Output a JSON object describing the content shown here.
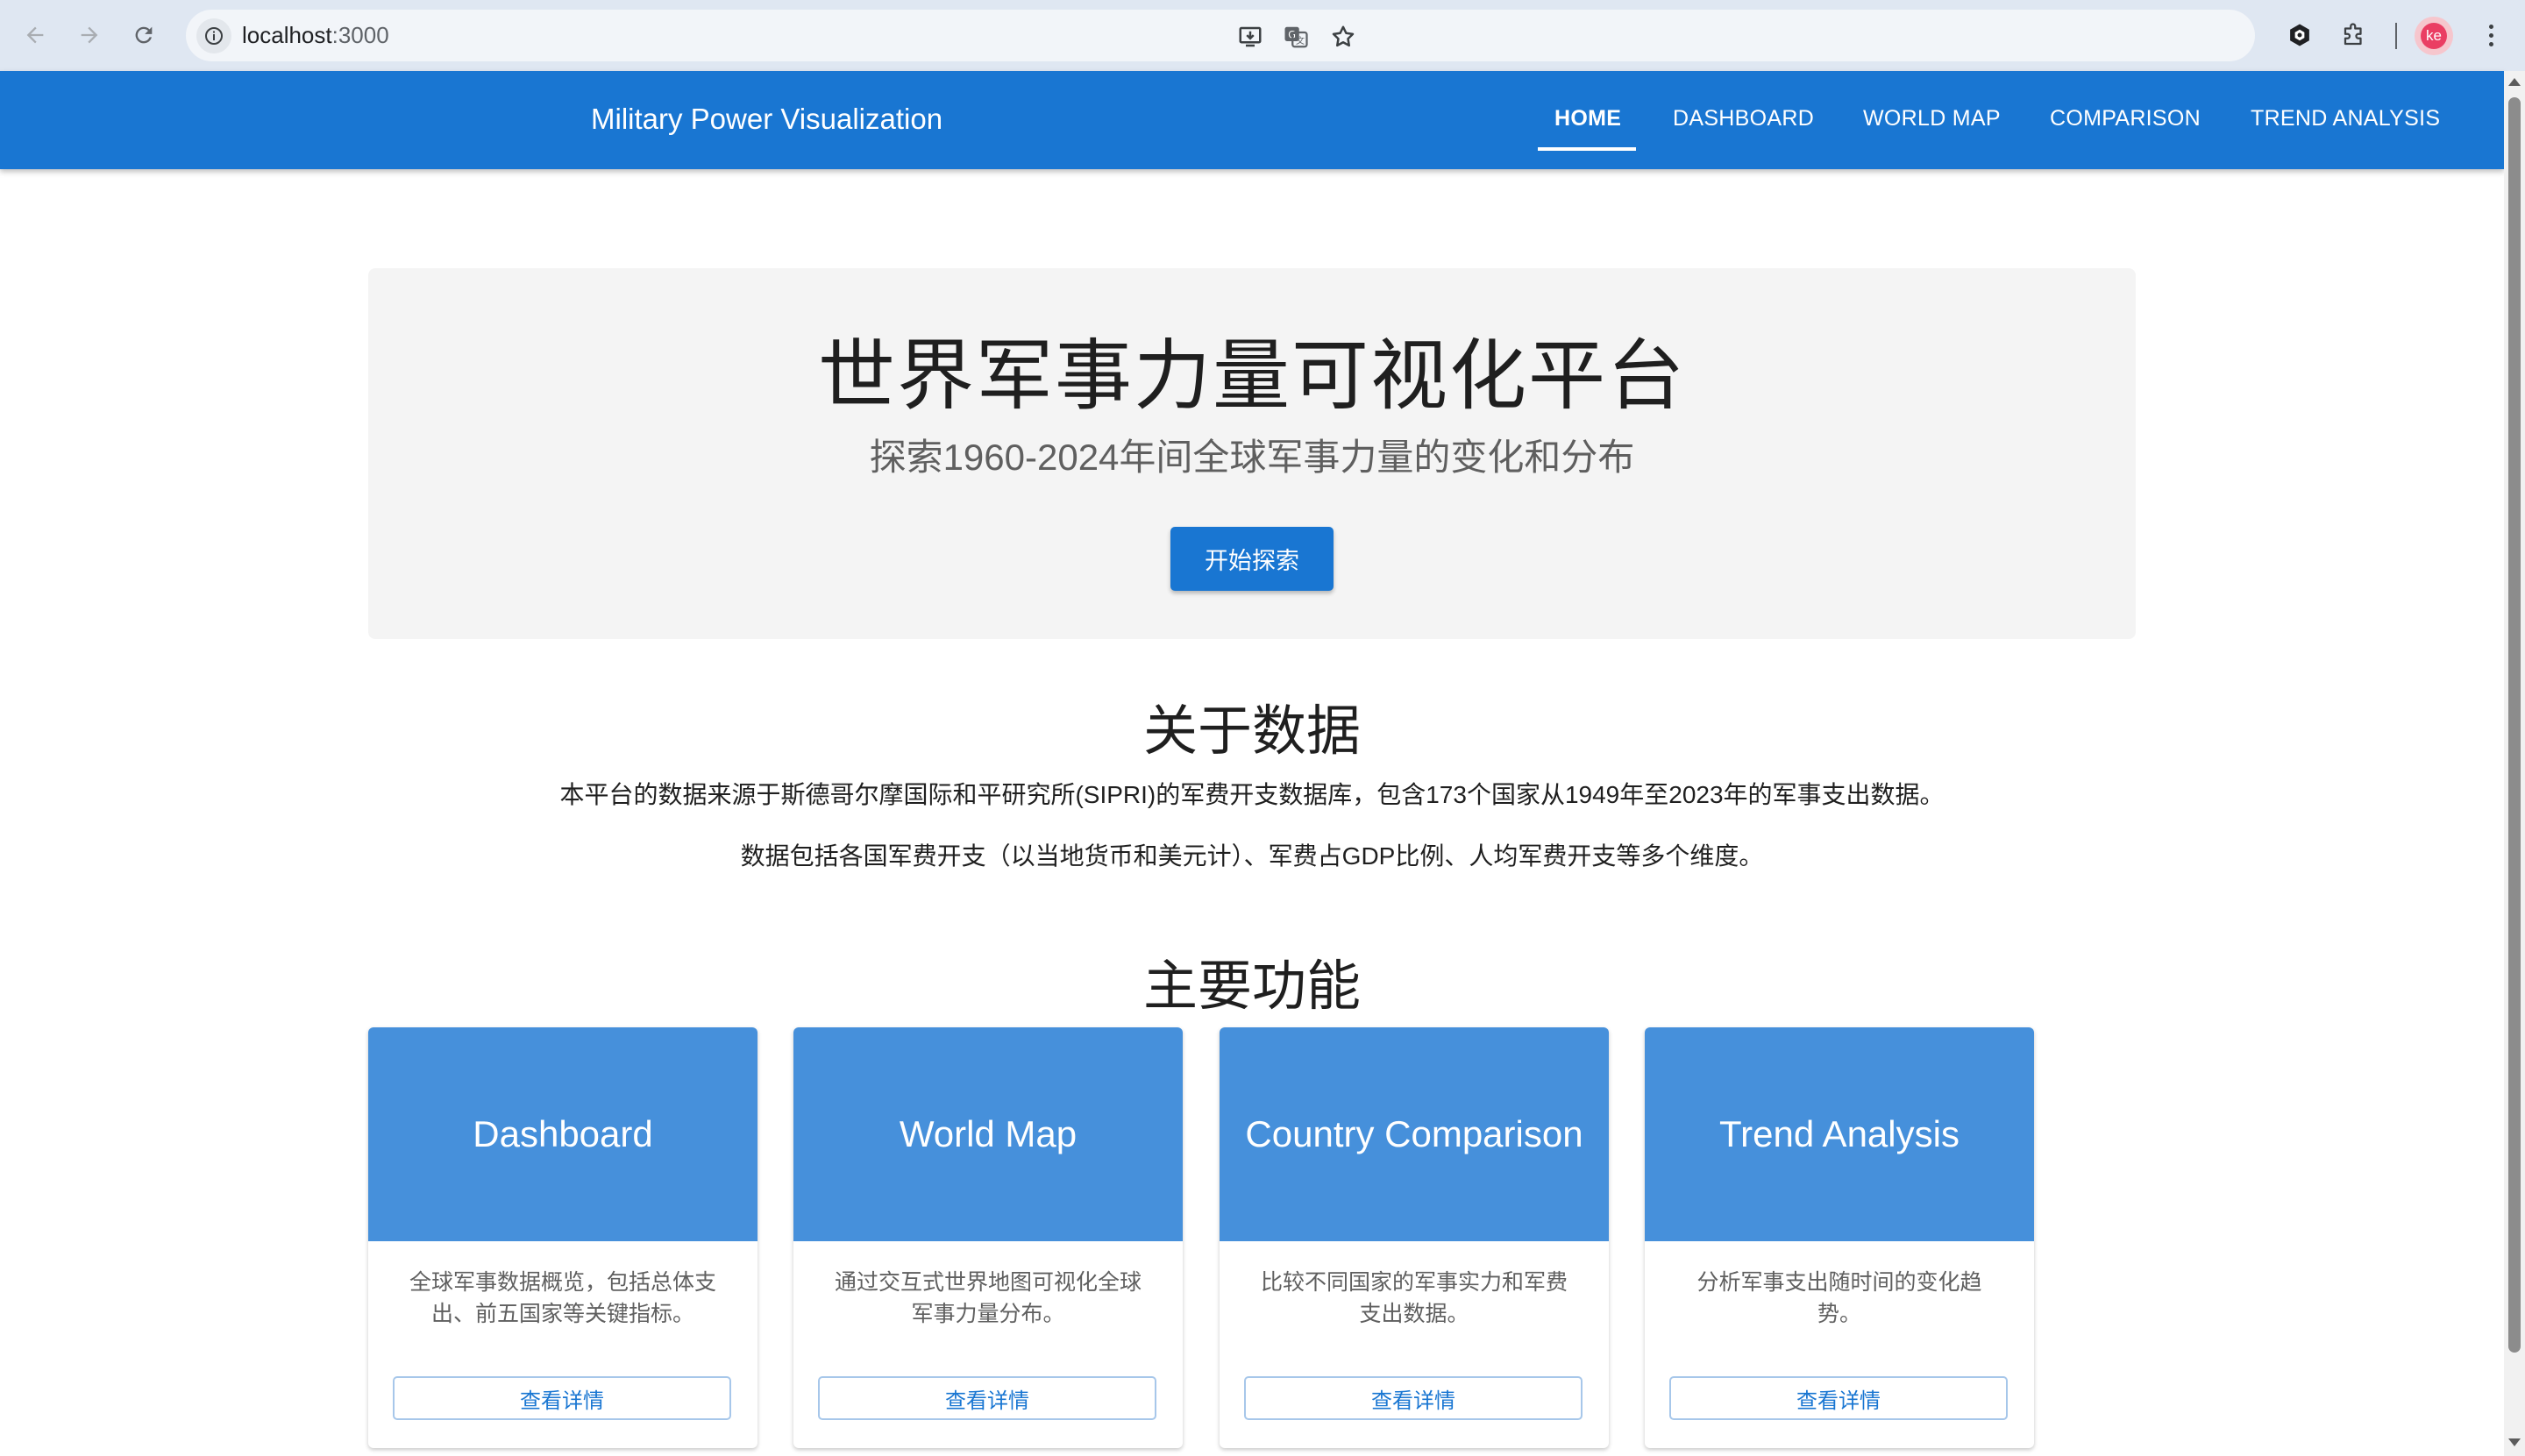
{
  "browser": {
    "url_host": "localhost",
    "url_port": ":3000",
    "avatar_initials": "ke",
    "icons": [
      "back-icon",
      "forward-icon",
      "reload-icon",
      "site-info-icon",
      "install-app-icon",
      "translate-icon",
      "bookmark-star-icon",
      "extension-icon",
      "puzzle-icon",
      "menu-icon"
    ]
  },
  "appbar": {
    "brand": "Military Power Visualization",
    "nav": [
      {
        "label": "HOME",
        "active": true
      },
      {
        "label": "DASHBOARD"
      },
      {
        "label": "WORLD MAP"
      },
      {
        "label": "COMPARISON"
      },
      {
        "label": "TREND ANALYSIS"
      }
    ],
    "color": "#1976d2"
  },
  "hero": {
    "title": "世界军事力量可视化平台",
    "subtitle": "探索1960-2024年间全球军事力量的变化和分布",
    "button": "开始探索"
  },
  "about": {
    "title": "关于数据",
    "line1": "本平台的数据来源于斯德哥尔摩国际和平研究所(SIPRI)的军费开支数据库，包含173个国家从1949年至2023年的军事支出数据。",
    "line2": "数据包括各国军费开支（以当地货币和美元计）、军费占GDP比例、人均军费开支等多个维度。"
  },
  "features": {
    "title": "主要功能",
    "cards": [
      {
        "title": "Dashboard",
        "desc": "全球军事数据概览，包括总体支出、前五国家等关键指标。",
        "button": "查看详情"
      },
      {
        "title": "World Map",
        "desc": "通过交互式世界地图可视化全球军事力量分布。",
        "button": "查看详情"
      },
      {
        "title": "Country Comparison",
        "desc": "比较不同国家的军事实力和军费支出数据。",
        "button": "查看详情"
      },
      {
        "title": "Trend Analysis",
        "desc": "分析军事支出随时间的变化趋势。",
        "button": "查看详情"
      }
    ],
    "card_header_color": "#4690db"
  }
}
